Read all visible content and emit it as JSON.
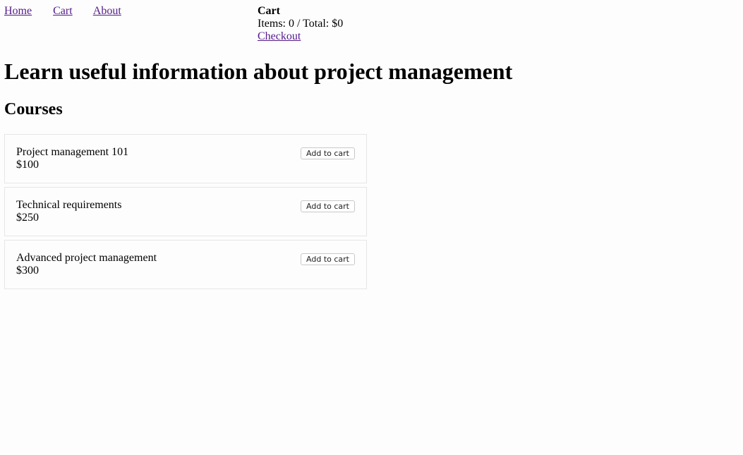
{
  "nav": {
    "items": [
      {
        "label": "Home"
      },
      {
        "label": "Cart"
      },
      {
        "label": "About"
      }
    ]
  },
  "cart": {
    "title": "Cart",
    "summary": "Items: 0 / Total: $0",
    "checkout_label": "Checkout"
  },
  "main": {
    "title": "Learn useful information about project management",
    "section_title": "Courses",
    "courses": [
      {
        "name": "Project management 101",
        "price": "$100",
        "button_label": "Add to cart"
      },
      {
        "name": "Technical requirements",
        "price": "$250",
        "button_label": "Add to cart"
      },
      {
        "name": "Advanced project management",
        "price": "$300",
        "button_label": "Add to cart"
      }
    ]
  },
  "colors": {
    "link": "#551a8b",
    "background": "#fdfdfd",
    "card_border": "#e6e6e6"
  }
}
